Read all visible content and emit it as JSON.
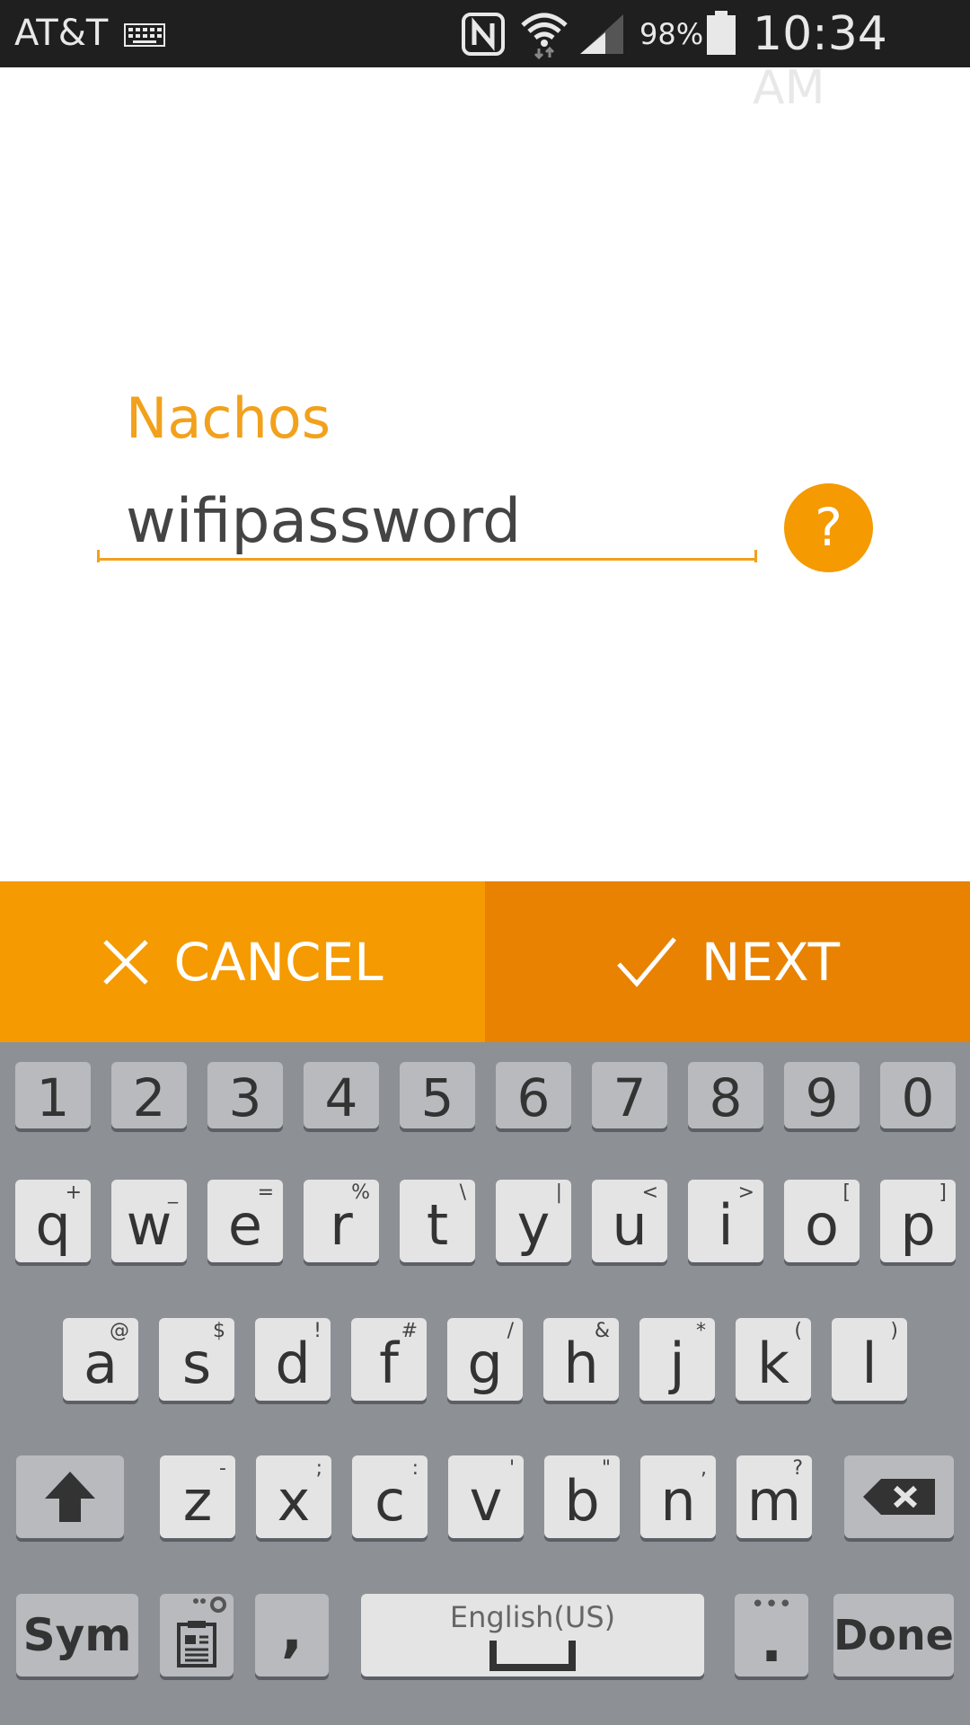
{
  "status_bar": {
    "carrier": "AT&T",
    "battery": "98%",
    "time": "10:34 AM",
    "icons": [
      "keyboard-icon",
      "nfc-icon",
      "wifi-icon",
      "signal-icon",
      "battery-icon"
    ]
  },
  "form": {
    "network_label": "Nachos",
    "password_value": "wifipassword",
    "help_label": "?"
  },
  "actions": {
    "cancel_label": "CANCEL",
    "next_label": "NEXT"
  },
  "colors": {
    "accent": "#f2a11c",
    "cancel_bg": "#f59a00",
    "next_bg": "#e88200",
    "keyboard_bg": "#8d9196"
  },
  "keyboard": {
    "row_numbers": [
      "1",
      "2",
      "3",
      "4",
      "5",
      "6",
      "7",
      "8",
      "9",
      "0"
    ],
    "row_top": [
      {
        "key": "q",
        "hint": "+"
      },
      {
        "key": "w",
        "hint": "_"
      },
      {
        "key": "e",
        "hint": "="
      },
      {
        "key": "r",
        "hint": "%"
      },
      {
        "key": "t",
        "hint": "\\"
      },
      {
        "key": "y",
        "hint": "|"
      },
      {
        "key": "u",
        "hint": "<"
      },
      {
        "key": "i",
        "hint": ">"
      },
      {
        "key": "o",
        "hint": "["
      },
      {
        "key": "p",
        "hint": "]"
      }
    ],
    "row_home": [
      {
        "key": "a",
        "hint": "@"
      },
      {
        "key": "s",
        "hint": "$"
      },
      {
        "key": "d",
        "hint": "!"
      },
      {
        "key": "f",
        "hint": "#"
      },
      {
        "key": "g",
        "hint": "/"
      },
      {
        "key": "h",
        "hint": "&"
      },
      {
        "key": "j",
        "hint": "*"
      },
      {
        "key": "k",
        "hint": "("
      },
      {
        "key": "l",
        "hint": ")"
      }
    ],
    "row_bottom": [
      {
        "key": "z",
        "hint": "-"
      },
      {
        "key": "x",
        "hint": ";"
      },
      {
        "key": "c",
        "hint": ":"
      },
      {
        "key": "v",
        "hint": "'"
      },
      {
        "key": "b",
        "hint": "\""
      },
      {
        "key": "n",
        "hint": ","
      },
      {
        "key": "m",
        "hint": "?"
      }
    ],
    "sym_label": "Sym",
    "comma_label": ",",
    "space_label": "English(US)",
    "period_label": ".",
    "done_label": "Done"
  }
}
